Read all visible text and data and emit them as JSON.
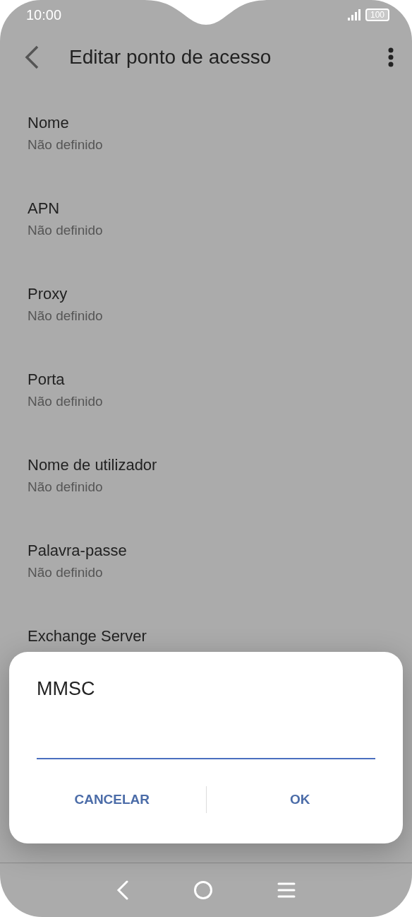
{
  "status_bar": {
    "time": "10:00",
    "battery": "100"
  },
  "header": {
    "title": "Editar ponto de acesso"
  },
  "items": [
    {
      "title": "Nome",
      "value": "Não definido"
    },
    {
      "title": "APN",
      "value": "Não definido"
    },
    {
      "title": "Proxy",
      "value": "Não definido"
    },
    {
      "title": "Porta",
      "value": "Não definido"
    },
    {
      "title": "Nome de utilizador",
      "value": "Não definido"
    },
    {
      "title": "Palavra-passe",
      "value": "Não definido"
    },
    {
      "title": "Exchange Server"
    }
  ],
  "dialog": {
    "title": "MMSC",
    "buttons": [
      "CANCELAR",
      "OK"
    ]
  }
}
